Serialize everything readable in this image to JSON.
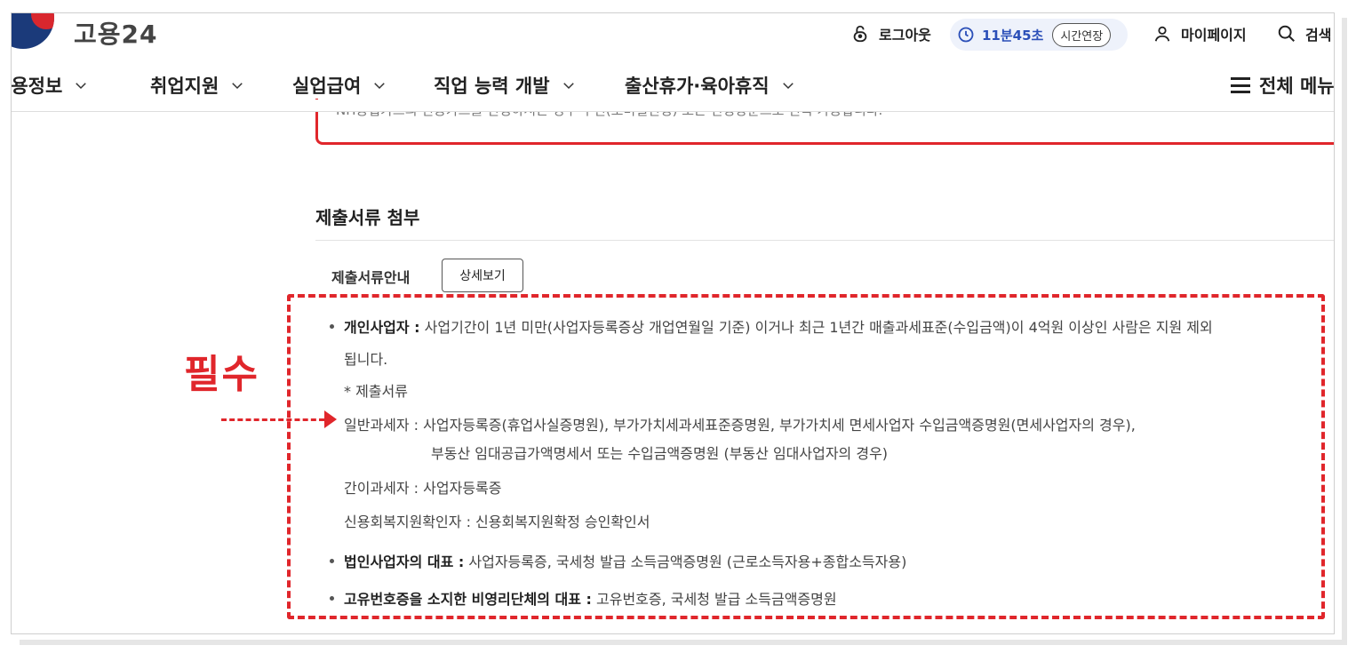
{
  "header": {
    "logo_text": "고용24",
    "logout_label": "로그아웃",
    "timer_value": "11분45초",
    "extend_label": "시간연장",
    "mypage_label": "마이페이지",
    "search_label": "검색"
  },
  "nav": {
    "items": [
      {
        "label": "채용정보"
      },
      {
        "label": "취업지원"
      },
      {
        "label": "실업급여"
      },
      {
        "label": "직업 능력 개발"
      },
      {
        "label": "출산휴가·육아휴직"
      }
    ],
    "all_menu_label": "전체 메뉴"
  },
  "notice": {
    "text": "NH농협카드의 신용카드를 신청하시는 경우 우편(도미널신청) 또는 신청방문으로 신속 가능합니다."
  },
  "section": {
    "title": "제출서류 첨부",
    "guide_label": "제출서류안내",
    "detail_button": "상세보기"
  },
  "annotation": {
    "required_label": "필수"
  },
  "documents": {
    "individual_title": "개인사업자 :",
    "individual_desc": "사업기간이 1년 미만(사업자등록증상 개업연월일 기준) 이거나 최근 1년간 매출과세표준(수입금액)이 4억원 이상인 사람은 지원 제외",
    "individual_desc_cont": "됩니다.",
    "submit_docs_label": "* 제출서류",
    "general_taxpayer": "일반과세자 : 사업자등록증(휴업사실증명원), 부가가치세과세표준증명원, 부가가치세 면세사업자 수입금액증명원(면세사업자의 경우),",
    "general_taxpayer_cont": "부동산 임대공급가액명세서 또는 수입금액증명원 (부동산 임대사업자의 경우)",
    "simple_taxpayer": "간이과세자 : 사업자등록증",
    "credit_recovery": "신용회복지원확인자 : 신용회복지원확정 승인확인서",
    "corporate_title": "법인사업자의 대표 :",
    "corporate_desc": "사업자등록증, 국세청 발급 소득금액증명원 (근로소득자용+종합소득자용)",
    "nonprofit_title": "고유번호증을 소지한 비영리단체의 대표 :",
    "nonprofit_desc": "고유번호증, 국세청 발급 소득금액증명원"
  },
  "colors": {
    "accent_red": "#e0262b",
    "accent_blue": "#2b4fb8"
  }
}
